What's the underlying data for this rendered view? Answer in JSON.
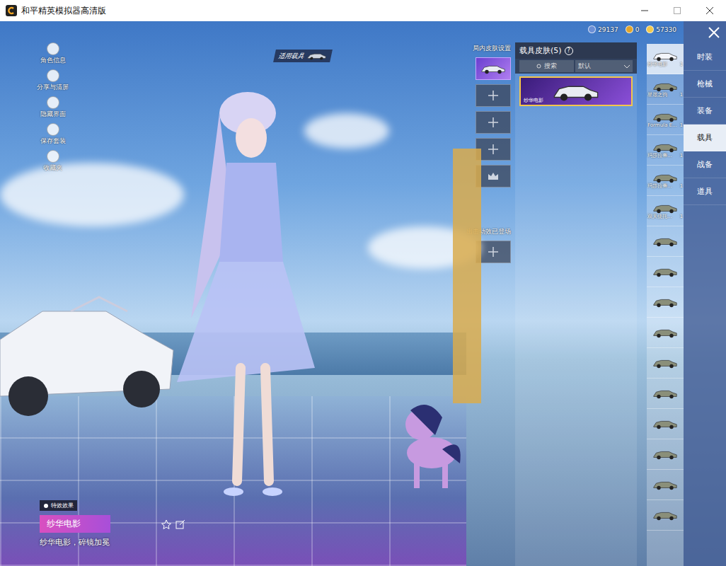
{
  "window": {
    "title": "和平精英模拟器高清版"
  },
  "currencies": [
    {
      "value": "29137"
    },
    {
      "value": "0"
    },
    {
      "value": "57330"
    }
  ],
  "left_tools": [
    {
      "label": "角色信息"
    },
    {
      "label": "分享与清屏"
    },
    {
      "label": "隐藏界面"
    },
    {
      "label": "保存套装"
    },
    {
      "label": "收藏夹"
    }
  ],
  "vehicle_tag": "适用载具",
  "slot_panel": {
    "title": "局内皮肤设置",
    "slots": [
      {
        "filled": true,
        "kind": "car"
      },
      {
        "filled": false,
        "kind": "plus"
      },
      {
        "filled": false,
        "kind": "plus"
      },
      {
        "filled": false,
        "kind": "plus"
      },
      {
        "filled": false,
        "kind": "crown"
      }
    ],
    "effect_label": "出击动效已登场",
    "effect_slot": {
      "filled": false,
      "kind": "plus"
    }
  },
  "skin_panel": {
    "title": "载具皮肤(5)",
    "help": "?",
    "search": "搜索",
    "sort": "默认",
    "items": [
      {
        "name": "纱华电影",
        "selected": true
      }
    ]
  },
  "thumbs": [
    {
      "label": "纱华电影",
      "count": "1",
      "selected": true
    },
    {
      "label": "星愿之驹",
      "count": "1",
      "selected": false
    },
    {
      "label": "Formula E...",
      "count": "1",
      "selected": false
    },
    {
      "label": "玛莎拉蒂...",
      "count": "1",
      "selected": false
    },
    {
      "label": "玛莎拉蒂...",
      "count": "1",
      "selected": false
    },
    {
      "label": "双天使托...",
      "count": "1",
      "selected": false
    },
    {
      "label": "",
      "count": "",
      "selected": false
    },
    {
      "label": "",
      "count": "",
      "selected": false
    },
    {
      "label": "",
      "count": "",
      "selected": false
    },
    {
      "label": "",
      "count": "",
      "selected": false
    },
    {
      "label": "",
      "count": "",
      "selected": false
    },
    {
      "label": "",
      "count": "",
      "selected": false
    },
    {
      "label": "",
      "count": "",
      "selected": false
    },
    {
      "label": "",
      "count": "",
      "selected": false
    },
    {
      "label": "",
      "count": "",
      "selected": false
    },
    {
      "label": "",
      "count": "",
      "selected": false
    }
  ],
  "categories": [
    {
      "label": "时装",
      "selected": false
    },
    {
      "label": "枪械",
      "selected": false
    },
    {
      "label": "装备",
      "selected": false
    },
    {
      "label": "载具",
      "selected": true
    },
    {
      "label": "战备",
      "selected": false
    },
    {
      "label": "道具",
      "selected": false
    }
  ],
  "effect": {
    "tag": "特效效果",
    "name": "纱华电影",
    "desc": "纱华电影，碎镜加冕"
  }
}
